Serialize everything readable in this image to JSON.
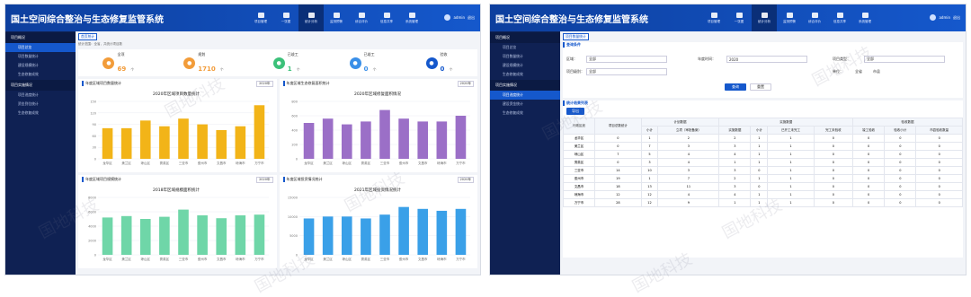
{
  "left": {
    "title": "国土空间综合整治与生态修复监管系统",
    "nav": [
      "项目管理",
      "一张图",
      "统计分析",
      "监测预警",
      "综合评价",
      "信息共享",
      "系统管理"
    ],
    "nav_active": 2,
    "user": "admin",
    "logout": "退出",
    "sidebar": [
      {
        "group": "项目概况",
        "items": [
          "项目总览",
          "项目数量统计",
          "建设规模统计",
          "生态修复成效"
        ]
      },
      {
        "group": "项目实施情况",
        "items": [
          "项目进度统计",
          "资金到位统计",
          "生态修复成效"
        ]
      }
    ],
    "tab": "首页统计",
    "tip": "统计范围：全省，共统计项目数",
    "stats": [
      {
        "label": "全项",
        "value": "69",
        "unit": "个",
        "color": "#f29c3a",
        "icon": "building-icon"
      },
      {
        "label": "规划",
        "value": "1710",
        "unit": "个",
        "color": "#f29c3a",
        "icon": "plan-icon"
      },
      {
        "label": "已竣工",
        "value": "1",
        "unit": "个",
        "color": "#3cc17a",
        "icon": "check-icon"
      },
      {
        "label": "已竣工",
        "value": "0",
        "unit": "个",
        "color": "#3a8fe8",
        "icon": "flag-icon"
      },
      {
        "label": "验收",
        "value": "0",
        "unit": "个",
        "color": "#1558cc",
        "icon": "doc-icon"
      }
    ],
    "charts": [
      {
        "header": "年度区域项目数量统计",
        "select": "2020年",
        "chart_data": {
          "type": "bar",
          "title": "2020年区域项目数量统计",
          "color": "#f2b418",
          "categories": [
            "龙华区",
            "美兰区",
            "琼山区",
            "秀英区",
            "三亚市",
            "儋州市",
            "文昌市",
            "琼海市",
            "万宁市"
          ],
          "values": [
            80,
            80,
            100,
            85,
            105,
            90,
            75,
            85,
            140
          ],
          "ylim": [
            0,
            150
          ],
          "yticks": [
            "0",
            "30",
            "60",
            "90",
            "120",
            "150"
          ]
        }
      },
      {
        "header": "年度区域生态修复面积统计",
        "select": "2020年",
        "chart_data": {
          "type": "bar",
          "title": "2020年区域修复面积情况",
          "color": "#9b6fc7",
          "categories": [
            "龙华区",
            "美兰区",
            "琼山区",
            "秀英区",
            "三亚市",
            "儋州市",
            "文昌市",
            "琼海市",
            "万宁市"
          ],
          "values": [
            500,
            560,
            480,
            520,
            680,
            560,
            520,
            520,
            600
          ],
          "ylim": [
            0,
            800
          ],
          "yticks": [
            "0",
            "200",
            "400",
            "600",
            "800"
          ]
        }
      },
      {
        "header": "年度区域项目规模统计",
        "select": "2020年",
        "chart_data": {
          "type": "bar",
          "title": "2018年区域规模面积统计",
          "color": "#6fd6a8",
          "categories": [
            "龙华区",
            "美兰区",
            "琼山区",
            "秀英区",
            "三亚市",
            "儋州市",
            "文昌市",
            "琼海市",
            "万宁市"
          ],
          "values": [
            5200,
            5400,
            5000,
            5300,
            6300,
            5500,
            5100,
            5500,
            5600
          ],
          "ylim": [
            0,
            8000
          ],
          "yticks": [
            "0",
            "2000",
            "4000",
            "6000",
            "8000"
          ]
        }
      },
      {
        "header": "年度区域投资情况统计",
        "select": "2020年",
        "chart_data": {
          "type": "bar",
          "title": "2021年区域投资情况统计",
          "color": "#3aa0e8",
          "categories": [
            "龙华区",
            "美兰区",
            "琼山区",
            "秀英区",
            "三亚市",
            "儋州市",
            "文昌市",
            "琼海市",
            "万宁市"
          ],
          "values": [
            9500,
            10000,
            10000,
            9500,
            10500,
            12500,
            12000,
            11500,
            12000
          ],
          "ylim": [
            0,
            15000
          ],
          "yticks": [
            "0",
            "5000",
            "10000",
            "15000"
          ]
        }
      }
    ]
  },
  "right": {
    "title": "国土空间综合整治与生态修复监管系统",
    "nav": [
      "项目管理",
      "一张图",
      "统计分析",
      "监测预警",
      "综合评价",
      "信息共享",
      "系统管理"
    ],
    "nav_active": 2,
    "user": "admin",
    "logout": "退出",
    "sidebar": [
      {
        "group": "项目概况",
        "items": [
          "项目总览",
          "项目数量统计",
          "建设规模统计",
          "生态修复成效"
        ]
      },
      {
        "group": "项目实施情况",
        "items": [
          "项目进度统计",
          "建设资金统计",
          "生态修复成效"
        ]
      }
    ],
    "tab": "项目数量统计",
    "section_filter": "查询条件",
    "filters": {
      "region_label": "区域：",
      "region_value": "全部",
      "year_label": "年度时间：",
      "year_value": "2020",
      "type_label": "项目类型：",
      "type_value": "全部",
      "level_label": "项目级别：",
      "level_value": "全部",
      "unit_label": "单位：",
      "unit_opt1": "全省",
      "unit_opt2": "市县",
      "query": "查询",
      "reset": "重置"
    },
    "section_result": "统计结果列表",
    "export": "导出",
    "table": {
      "head1": [
        "行政区划",
        "项目总数统计",
        "计划数据",
        "实施数据",
        "验收数据"
      ],
      "head2": [
        "小计",
        "立项（审批备案）",
        "实施数据",
        "小计",
        "已开工未完工",
        "完工未验收",
        "竣工验收",
        "验收小计",
        "市县验收数量",
        "省级验收数量"
      ],
      "rows": [
        [
          "龙华区",
          "0",
          "1",
          "2",
          "2",
          "1",
          "1",
          "0",
          "0",
          "0",
          "0"
        ],
        [
          "美兰区",
          "0",
          "7",
          "3",
          "3",
          "1",
          "1",
          "0",
          "0",
          "0",
          "0"
        ],
        [
          "琼山区",
          "7",
          "5",
          "4",
          "4",
          "1",
          "1",
          "0",
          "0",
          "0",
          "0"
        ],
        [
          "秀英区",
          "0",
          "3",
          "4",
          "1",
          "1",
          "1",
          "0",
          "0",
          "0",
          "0"
        ],
        [
          "三亚市",
          "14",
          "10",
          "3",
          "3",
          "0",
          "1",
          "0",
          "0",
          "0",
          "0"
        ],
        [
          "儋州市",
          "19",
          "1",
          "7",
          "2",
          "1",
          "1",
          "0",
          "0",
          "0",
          "0"
        ],
        [
          "文昌市",
          "18",
          "13",
          "11",
          "3",
          "0",
          "1",
          "0",
          "0",
          "0",
          "0"
        ],
        [
          "琼海市",
          "12",
          "12",
          "4",
          "4",
          "1",
          "1",
          "0",
          "0",
          "0",
          "0"
        ],
        [
          "万宁市",
          "28",
          "12",
          "9",
          "1",
          "1",
          "1",
          "0",
          "0",
          "0",
          "0"
        ]
      ]
    }
  },
  "watermark": "国地科技"
}
